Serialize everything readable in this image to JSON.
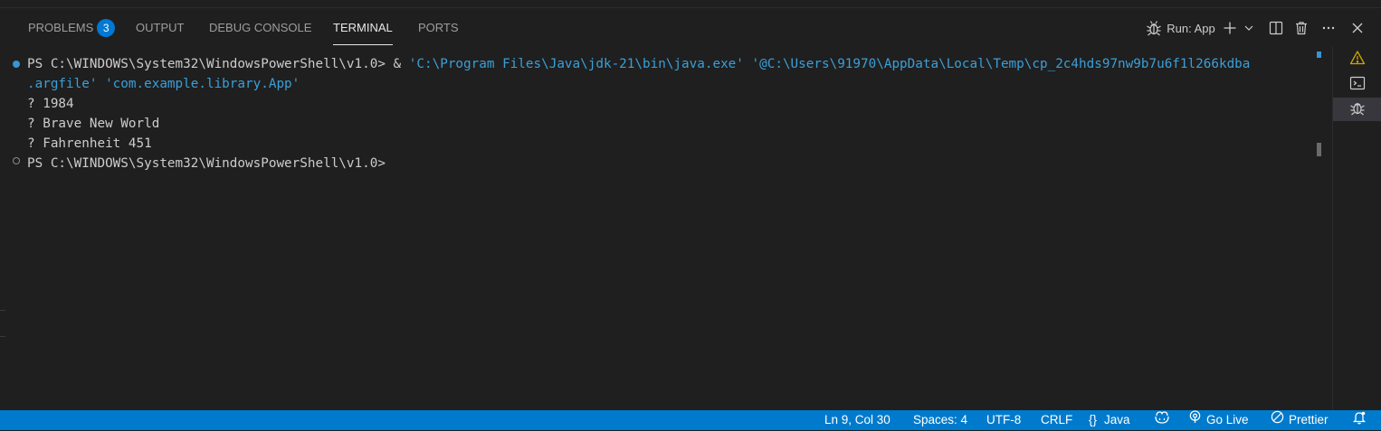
{
  "panel": {
    "tabs": [
      {
        "label": "PROBLEMS",
        "badge": "3"
      },
      {
        "label": "OUTPUT"
      },
      {
        "label": "DEBUG CONSOLE"
      },
      {
        "label": "TERMINAL",
        "active": true
      },
      {
        "label": "PORTS"
      }
    ],
    "toolbar": {
      "run_label": "Run: App",
      "icons": [
        "bug-icon",
        "add-icon",
        "chevron-down-icon",
        "split-icon",
        "trash-icon",
        "more-icon",
        "close-icon"
      ]
    }
  },
  "terminal": {
    "prompt": "PS C:\\WINDOWS\\System32\\WindowsPowerShell\\v1.0>",
    "command_prefix": " & ",
    "command_part1": "'C:\\Program Files\\Java\\jdk-21\\bin\\java.exe' '@C:\\Users\\91970\\AppData\\Local\\Temp\\cp_2c4hds97nw9b7u6f1l266kdba",
    "command_part2": ".argfile' 'com.example.library.App'",
    "output": [
      "? 1984",
      "? Brave New World",
      "? Fahrenheit 451"
    ],
    "prompt2": "PS C:\\WINDOWS\\System32\\WindowsPowerShell\\v1.0>"
  },
  "side_tabs": [
    "warning-icon",
    "terminal-icon",
    "debug-icon"
  ],
  "statusbar": {
    "position": "Ln 9, Col 30",
    "spaces": "Spaces: 4",
    "encoding": "UTF-8",
    "eol": "CRLF",
    "language": "Java",
    "language_icon": "{}",
    "copilot_icon": "copilot-icon",
    "golive": "Go Live",
    "prettier": "Prettier",
    "bell_icon": "bell-icon"
  },
  "colors": {
    "background": "#1f1f1f",
    "statusbar": "#007acc",
    "badge": "#0078d4",
    "string": "#3b9fd8",
    "warning": "#cca700"
  }
}
